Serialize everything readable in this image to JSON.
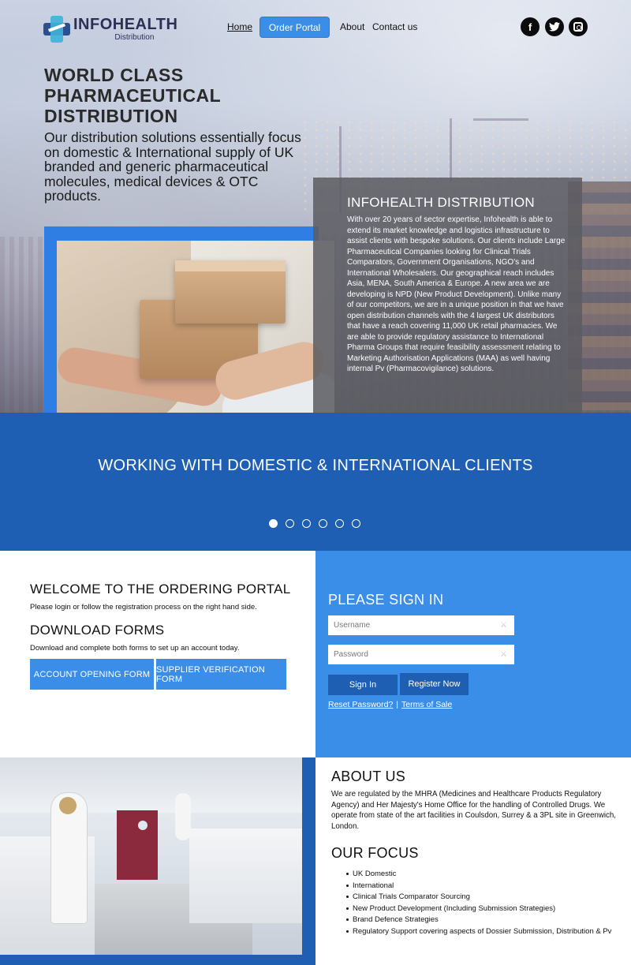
{
  "brand": {
    "name": "INFOHEALTH",
    "sub": "Distribution",
    "colors": {
      "primary": "#3b8ee8",
      "dark_blue": "#1e5fb3",
      "text": "#111111"
    }
  },
  "nav": {
    "home": "Home",
    "order_portal": "Order Portal",
    "about": "About",
    "contact": "Contact us"
  },
  "social": {
    "facebook": "f",
    "icons": [
      "facebook-icon",
      "twitter-icon",
      "instagram-icon"
    ]
  },
  "hero": {
    "title": "WORLD CLASS\nPHARMACEUTICAL\nDISTRIBUTION",
    "text": "Our distribution solutions essentially focus on domestic & International supply of UK branded and generic pharmaceutical molecules, medical devices & OTC products."
  },
  "info_panel": {
    "title": "INFOHEALTH DISTRIBUTION",
    "body": "With over 20 years of sector expertise, Infohealth is able to extend its market knowledge and logistics infrastructure to assist clients with bespoke solutions. Our clients include Large Pharmaceutical Companies looking for Clinical Trials Comparators, Government Organisations, NGO's and International Wholesalers. Our geographical reach includes Asia, MENA, South America & Europe. A new area we are developing is NPD (New Product Development). Unlike many of our competitors, we are in a unique position in that we have open distribution channels with the 4 largest UK distributors that have a reach covering 11,000 UK retail pharmacies. We are able to provide regulatory assistance to International Pharma Groups that require feasibility assessment relating to Marketing Authorisation Applications (MAA) as well having internal Pv (Pharmacovigilance) solutions."
  },
  "band": {
    "title": "WORKING WITH DOMESTIC & INTERNATIONAL CLIENTS",
    "slides": 6,
    "active_slide": 1
  },
  "portal": {
    "welcome_title": "WELCOME TO THE ORDERING PORTAL",
    "welcome_text": "Please login or follow the registration process on the right hand side.",
    "forms_title": "DOWNLOAD FORMS",
    "forms_text": "Download and complete both forms to set up an account today.",
    "account_form": "ACCOUNT OPENING FORM",
    "supplier_form": "SUPPLIER VERIFICATION FORM"
  },
  "signin": {
    "title": "PLEASE SIGN IN",
    "username_placeholder": "Username",
    "password_placeholder": "Password",
    "signin_label": "Sign In",
    "register_label": "Register Now",
    "reset_link": "Reset Password?",
    "separator": "|",
    "terms_link": "Terms of Sale"
  },
  "about": {
    "title": "ABOUT US",
    "text": "We are regulated by the MHRA (Medicines and Healthcare Products Regulatory Agency) and Her Majesty's Home Office for the handling of Controlled Drugs. We operate from state of the art facilities in Coulsdon, Surrey & a 3PL site in Greenwich, London.",
    "focus_title": "OUR FOCUS",
    "focus_items": [
      "UK Domestic",
      "International",
      "Clinical Trials Comparator Sourcing",
      "New Product Development (Including Submission Strategies)",
      "Brand Defence Strategies",
      "Regulatory Support covering aspects of Dossier Submission, Distribution & Pv"
    ]
  }
}
